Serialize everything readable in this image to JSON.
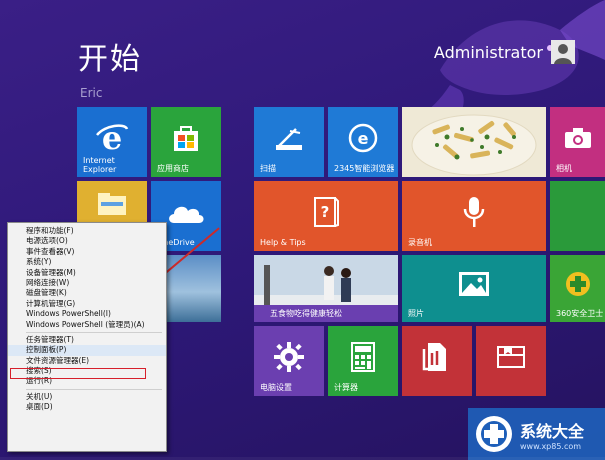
{
  "screen": {
    "title": "开始",
    "subtitle": "Eric",
    "user": "Administrator"
  },
  "tiles": {
    "ie": "Internet\nExplorer",
    "store": "应用商店",
    "scan": "扫描",
    "browser2345": "2345智能浏览器",
    "food": "",
    "camera": "相机",
    "files": "",
    "onedrive": "OneDrive",
    "help": "Help & Tips",
    "recorder": "录音机",
    "skydesk": "",
    "photo_couple": "五食物吃得健康轻松",
    "photos": "照片",
    "app360": "360安全卫士",
    "settings": "电脑设置",
    "calculator": "计算器",
    "reader": "",
    "readinglist": ""
  },
  "context_menu": {
    "items": [
      "程序和功能(F)",
      "电源选项(O)",
      "事件查看器(V)",
      "系统(Y)",
      "设备管理器(M)",
      "网络连接(W)",
      "磁盘管理(K)",
      "计算机管理(G)",
      "Windows PowerShell(I)",
      "Windows PowerShell (管理员)(A)",
      "任务管理器(T)",
      "控制面板(P)",
      "文件资源管理器(E)",
      "搜索(S)",
      "运行(R)",
      "关机(U)",
      "桌面(D)"
    ],
    "selected_index": 11
  },
  "watermark": {
    "text": "系统大全",
    "url": "www.xp85.com"
  },
  "colors": {
    "background": "#2c1a6b",
    "tile_blue": "#1f7ad6",
    "tile_green": "#2a9a3a",
    "tile_orange": "#e1552b",
    "tile_purple": "#6b3fb0",
    "tile_red": "#c23238",
    "highlight": "#d61f2b"
  }
}
